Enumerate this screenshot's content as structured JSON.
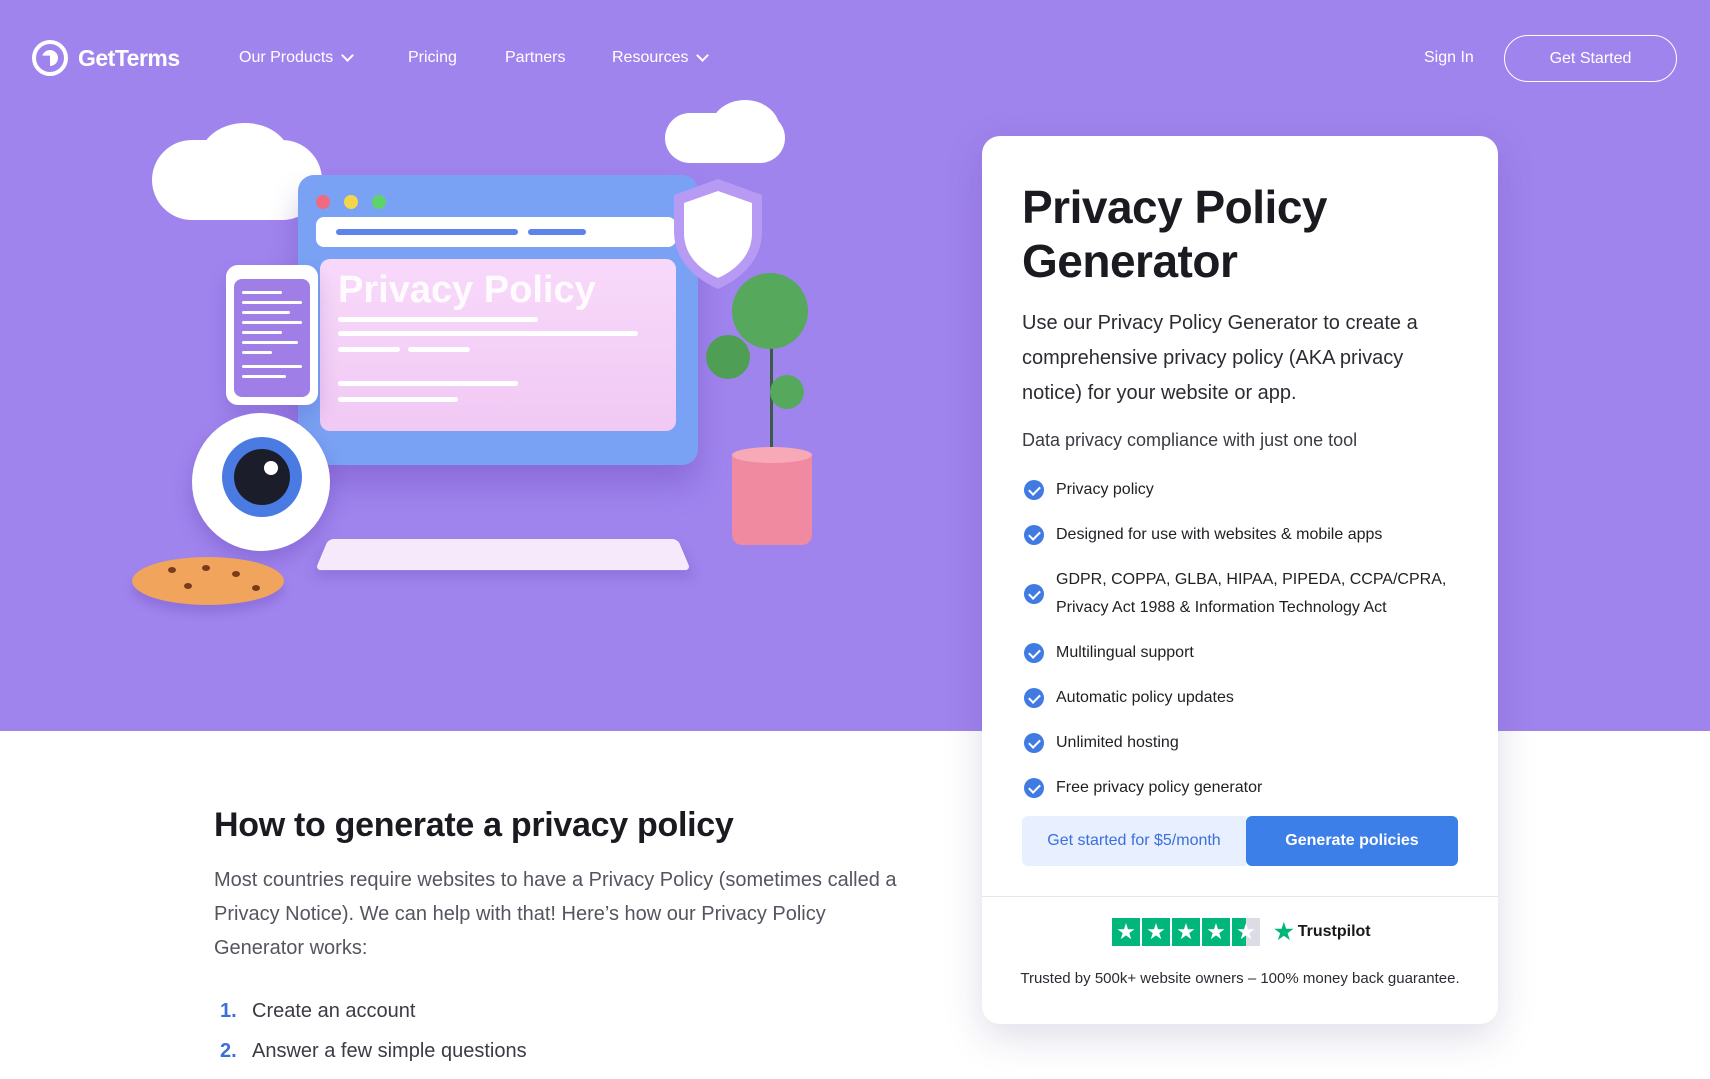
{
  "nav": {
    "brand": "GetTerms",
    "items": [
      {
        "label": "Our Products"
      },
      {
        "label": "Pricing"
      },
      {
        "label": "Partners"
      },
      {
        "label": "Resources"
      }
    ],
    "sign_in": "Sign In",
    "get_started": "Get Started"
  },
  "illustration": {
    "doc_title": "Privacy Policy",
    "icons": [
      "cloud",
      "browser-window",
      "shield-icon",
      "phone",
      "eye",
      "keyboard",
      "cookie",
      "plant"
    ]
  },
  "card": {
    "title_line1": "Privacy Policy",
    "title_line2": "Generator",
    "description": "Use our Privacy Policy Generator to create a comprehensive privacy policy (AKA privacy notice) for your website or app.",
    "subheading": "Data privacy compliance with just one tool",
    "features": [
      "Privacy policy",
      "Designed for use with websites & mobile apps",
      "GDPR, COPPA, GLBA, HIPAA, PIPEDA, CCPA/CPRA, Privacy Act 1988 & Information Technology Act",
      "Multilingual support",
      "Automatic policy updates",
      "Unlimited hosting",
      "Free privacy policy generator"
    ],
    "cta_secondary": "Get started for $5/month",
    "cta_primary": "Generate policies",
    "trustpilot_label": "Trustpilot",
    "trustpilot_rating": 4.5,
    "trust_text": "Trusted by 500k+ website owners – 100% money back guarantee."
  },
  "howto": {
    "title": "How to generate a privacy policy",
    "description": "Most countries require websites to have a Privacy Policy (sometimes called a Privacy Notice). We can help with that! Here’s how our Privacy Policy Generator works:",
    "steps": [
      {
        "num": "1.",
        "text": "Create an account"
      },
      {
        "num": "2.",
        "text": "Answer a few simple questions"
      }
    ]
  },
  "colors": {
    "hero_bg": "#a084ee",
    "primary": "#3d7fe9",
    "check": "#3f7be3",
    "trustpilot": "#00b67a"
  }
}
